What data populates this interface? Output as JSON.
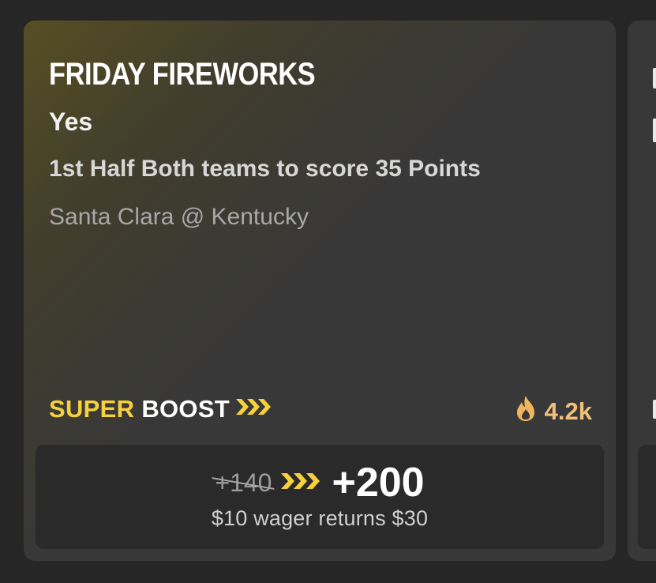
{
  "promo": {
    "title": "FRIDAY FIREWORKS",
    "selection": "Yes",
    "market": "1st Half Both teams to score 35 Points",
    "event": "Santa Clara @ Kentucky",
    "boost_label_1": "SUPER",
    "boost_label_2": "BOOST",
    "popularity": "4.2k",
    "old_odds": "+140",
    "new_odds": "+200",
    "returns_text": "$10 wager returns $30"
  },
  "colors": {
    "accent_yellow": "#f7d13c",
    "popularity_orange": "#f0c07a",
    "card_bg": "#383838",
    "page_bg": "#262626"
  },
  "icons": {
    "boost": "triple-chevron-right-icon",
    "popularity": "flame-icon"
  }
}
